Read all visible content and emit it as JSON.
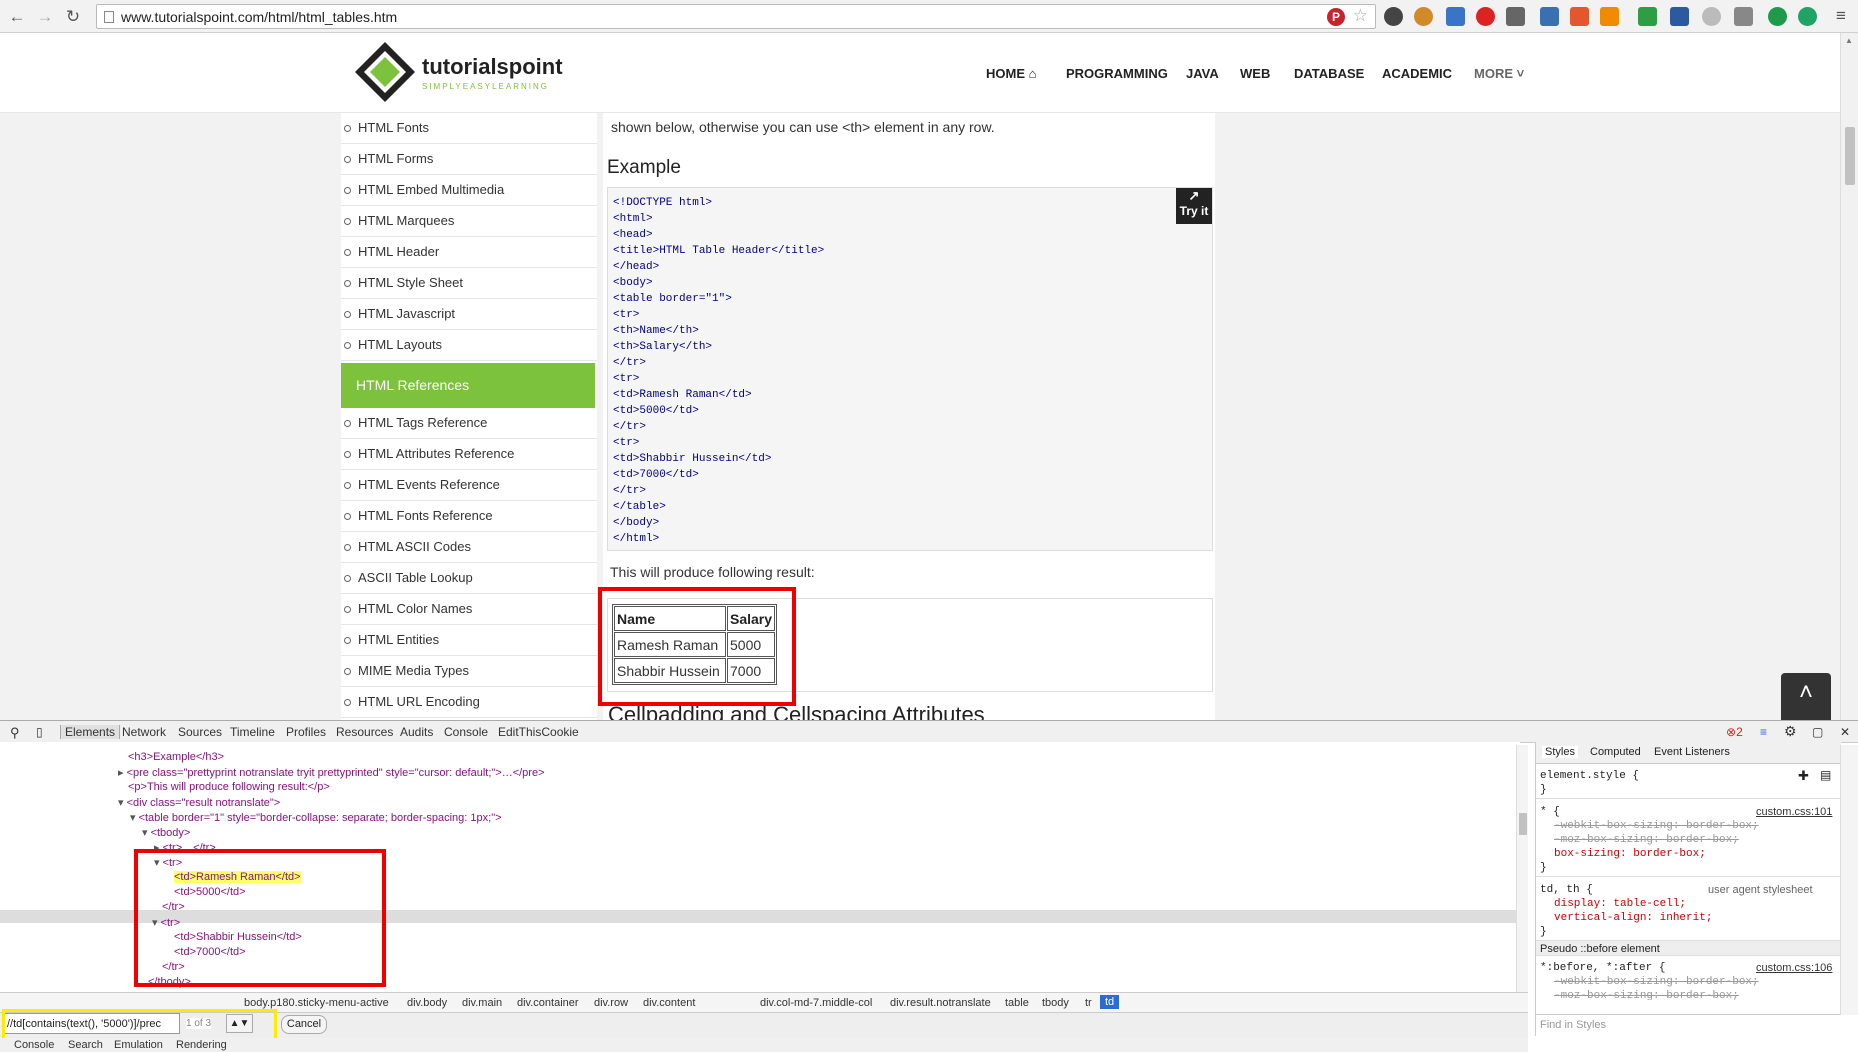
{
  "browser": {
    "url": "www.tutorialspoint.com/html/html_tables.htm"
  },
  "site": {
    "logo_text": "tutorialspoint",
    "logo_tagline": "SIMPLYEASYLEARNING",
    "nav": [
      "HOME",
      "PROGRAMMING",
      "JAVA",
      "WEB",
      "DATABASE",
      "ACADEMIC",
      "MORE"
    ]
  },
  "sidebar": {
    "items_top": [
      "HTML Fonts",
      "HTML Forms",
      "HTML Embed Multimedia",
      "HTML Marquees",
      "HTML Header",
      "HTML Style Sheet",
      "HTML Javascript",
      "HTML Layouts"
    ],
    "section_title": "HTML References",
    "items_bottom": [
      "HTML Tags Reference",
      "HTML Attributes Reference",
      "HTML Events Reference",
      "HTML Fonts Reference",
      "HTML ASCII Codes",
      "ASCII Table Lookup",
      "HTML Color Names",
      "HTML Entities",
      "MIME Media Types",
      "HTML URL Encoding"
    ]
  },
  "content": {
    "intro_text": "shown below, otherwise you can use <th> element in any row.",
    "example_heading": "Example",
    "code_lines": [
      "<!DOCTYPE html>",
      "<html>",
      "<head>",
      "<title>HTML Table Header</title>",
      "</head>",
      "<body>",
      "<table border=\"1\">",
      "<tr>",
      "<th>Name</th>",
      "<th>Salary</th>",
      "</tr>",
      "<tr>",
      "<td>Ramesh Raman</td>",
      "<td>5000</td>",
      "</tr>",
      "<tr>",
      "<td>Shabbir Hussein</td>",
      "<td>7000</td>",
      "</tr>",
      "</table>",
      "</body>",
      "</html>"
    ],
    "try_it_label": "Try it",
    "result_label": "This will produce following result:",
    "demo_table": {
      "headers": [
        "Name",
        "Salary"
      ],
      "rows": [
        [
          "Ramesh Raman",
          "5000"
        ],
        [
          "Shabbir Hussein",
          "7000"
        ]
      ]
    },
    "next_heading": "Cellpadding and Cellspacing Attributes"
  },
  "devtools": {
    "tabs": [
      "Elements",
      "Network",
      "Sources",
      "Timeline",
      "Profiles",
      "Resources",
      "Audits",
      "Console",
      "EditThisCookie"
    ],
    "error_count": "2",
    "dom_lines": [
      "<h3>Example</h3>",
      "<pre class=\"prettyprint notranslate tryit prettyprinted\" style=\"cursor: default;\">…</pre>",
      "<p>This will produce following result:</p>",
      "<div class=\"result notranslate\">",
      "<table border=\"1\" style=\"border-collapse: separate; border-spacing: 1px;\">",
      "<tbody>",
      "<tr>…</tr>",
      "<tr>",
      "<td>Ramesh Raman</td>",
      "<td>5000</td>",
      "</tr>",
      "<tr>",
      "<td>Shabbir Hussein</td>",
      "<td>7000</td>",
      "</tr>",
      "</tbody>"
    ],
    "styles_tabs": [
      "Styles",
      "Computed",
      "Event Listeners"
    ],
    "styles": {
      "element_style": "element.style {",
      "rule1_selector": "* {",
      "rule1_source": "custom.css:101",
      "rule1_props": [
        "-webkit-box-sizing: border-box;",
        "-moz-box-sizing: border-box;",
        "box-sizing: border-box;"
      ],
      "rule2_selector": "td, th {",
      "rule2_source": "user agent stylesheet",
      "rule2_props": [
        "display: table-cell;",
        "vertical-align: inherit;"
      ],
      "pseudo_title": "Pseudo ::before element",
      "rule3_selector": "*:before, *:after {",
      "rule3_source": "custom.css:106",
      "rule3_props": [
        "-webkit-box-sizing: border-box;",
        "-moz-box-sizing: border-box;"
      ],
      "find_placeholder": "Find in Styles"
    },
    "breadcrumbs": [
      "body.p180.sticky-menu-active",
      "div.body",
      "div.main",
      "div.container",
      "div.row",
      "div.content",
      "div.col-md-7.middle-col",
      "div.result.notranslate",
      "table",
      "tbody",
      "tr",
      "td"
    ],
    "search_query": "//td[contains(text(), '5000')]/prec",
    "search_count": "1 of 3",
    "cancel_label": "Cancel",
    "drawer_tabs": [
      "Console",
      "Search",
      "Emulation",
      "Rendering"
    ]
  }
}
